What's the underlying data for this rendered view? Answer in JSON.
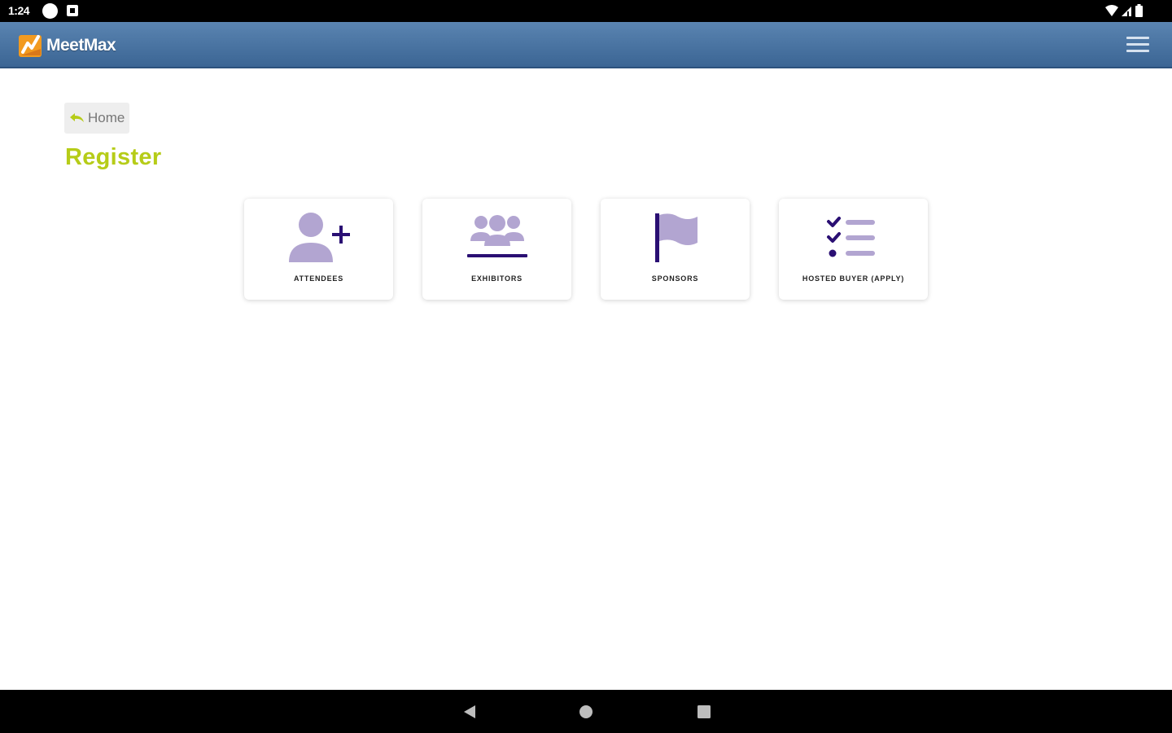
{
  "status_bar": {
    "time": "1:24",
    "icons": [
      "circle-icon",
      "notification-icon",
      "wifi-icon",
      "signal-icon",
      "battery-icon"
    ]
  },
  "app_bar": {
    "brand": "MeetMax",
    "menu_icon": "hamburger-menu-icon",
    "colors": {
      "gradient_top": "#5a84b1",
      "gradient_bottom": "#3b6594",
      "logo_orange": "#f29a1f"
    }
  },
  "breadcrumb": {
    "label": "Home",
    "icon": "back-arrow-icon"
  },
  "page": {
    "title": "Register",
    "title_color": "#b6cc18"
  },
  "tiles": [
    {
      "label": "ATTENDEES",
      "icon": "add-user-icon"
    },
    {
      "label": "EXHIBITORS",
      "icon": "group-icon"
    },
    {
      "label": "SPONSORS",
      "icon": "flag-icon"
    },
    {
      "label": "HOSTED BUYER (APPLY)",
      "icon": "checklist-icon"
    }
  ],
  "icon_colors": {
    "light": "#b2a5d1",
    "dark": "#2a0f73"
  },
  "nav_bar": {
    "icons": [
      "back-triangle-icon",
      "home-circle-icon",
      "recents-square-icon"
    ]
  }
}
